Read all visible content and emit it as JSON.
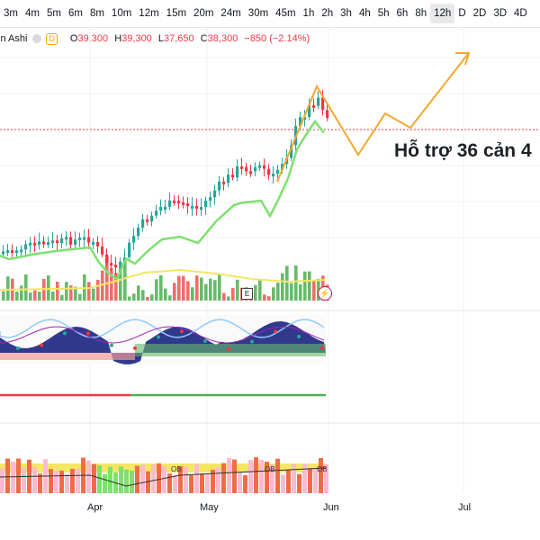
{
  "timeframes": [
    "3m",
    "4m",
    "5m",
    "6m",
    "8m",
    "10m",
    "12m",
    "15m",
    "20m",
    "24m",
    "30m",
    "45m",
    "1h",
    "2h",
    "3h",
    "4h",
    "5h",
    "6h",
    "8h",
    "12h",
    "D",
    "2D",
    "3D",
    "4D"
  ],
  "active_timeframe_index": 19,
  "legend": {
    "symbol": "in Ashi",
    "dbadge": "D",
    "o_label": "O",
    "o_value": "39,300",
    "h_label": "H",
    "h_value": "39,300",
    "l_label": "L",
    "l_value": "37,650",
    "c_label": "C",
    "c_value": "38,300",
    "change": "−850 (−2.14%)"
  },
  "annotation": "Hỗ trợ 36 cản 4",
  "x_axis_labels": [
    "Apr",
    "May",
    "Jun",
    "Jul"
  ],
  "indicator_badges": {
    "earnings": "E",
    "flash": "⚡",
    "ob": "OB"
  },
  "colors": {
    "up": "#26a69a",
    "down": "#f23645",
    "ma": "#7ee06e",
    "projection": "#f0a830",
    "volume_ma": "#f5e663"
  }
}
